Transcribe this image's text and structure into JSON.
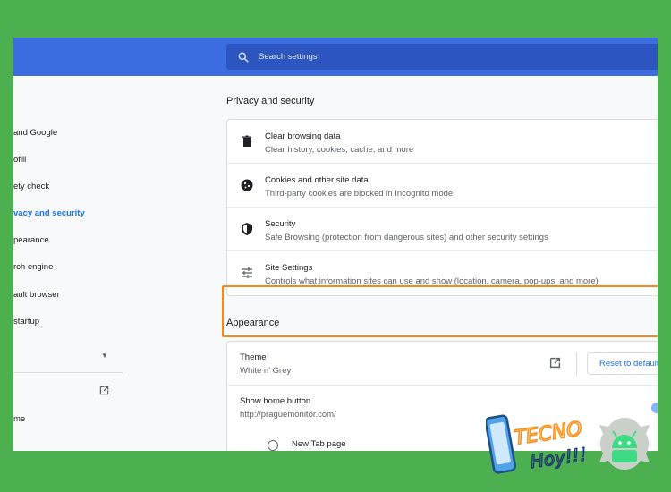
{
  "search": {
    "placeholder": "Search settings"
  },
  "sidebar": {
    "items": [
      {
        "label": "and Google"
      },
      {
        "label": "ofill"
      },
      {
        "label": "ety check"
      },
      {
        "label": "vacy and security"
      },
      {
        "label": "pearance"
      },
      {
        "label": "rch engine"
      },
      {
        "label": "ault browser"
      },
      {
        "label": "startup"
      },
      {
        "label": "me"
      }
    ]
  },
  "privacy": {
    "title": "Privacy and security",
    "rows": [
      {
        "title": "Clear browsing data",
        "subtitle": "Clear history, cookies, cache, and more",
        "icon": "trash-icon"
      },
      {
        "title": "Cookies and other site data",
        "subtitle": "Third-party cookies are blocked in Incognito mode",
        "icon": "cookie-icon"
      },
      {
        "title": "Security",
        "subtitle": "Safe Browsing (protection from dangerous sites) and other security settings",
        "icon": "shield-icon"
      },
      {
        "title": "Site Settings",
        "subtitle": "Controls what information sites can use and show (location, camera, pop-ups, and more)",
        "icon": "sliders-icon"
      }
    ]
  },
  "appearance": {
    "title": "Appearance",
    "theme": {
      "title": "Theme",
      "value": "White n' Grey",
      "reset_label": "Reset to default"
    },
    "home_button": {
      "title": "Show home button",
      "value": "http://praguemonitor.com/"
    },
    "new_tab_option": "New Tab page"
  },
  "colors": {
    "accent": "#1a73e8",
    "topbar": "#3b6ce0",
    "highlight": "#f48a1d",
    "frame": "#4caf50"
  }
}
